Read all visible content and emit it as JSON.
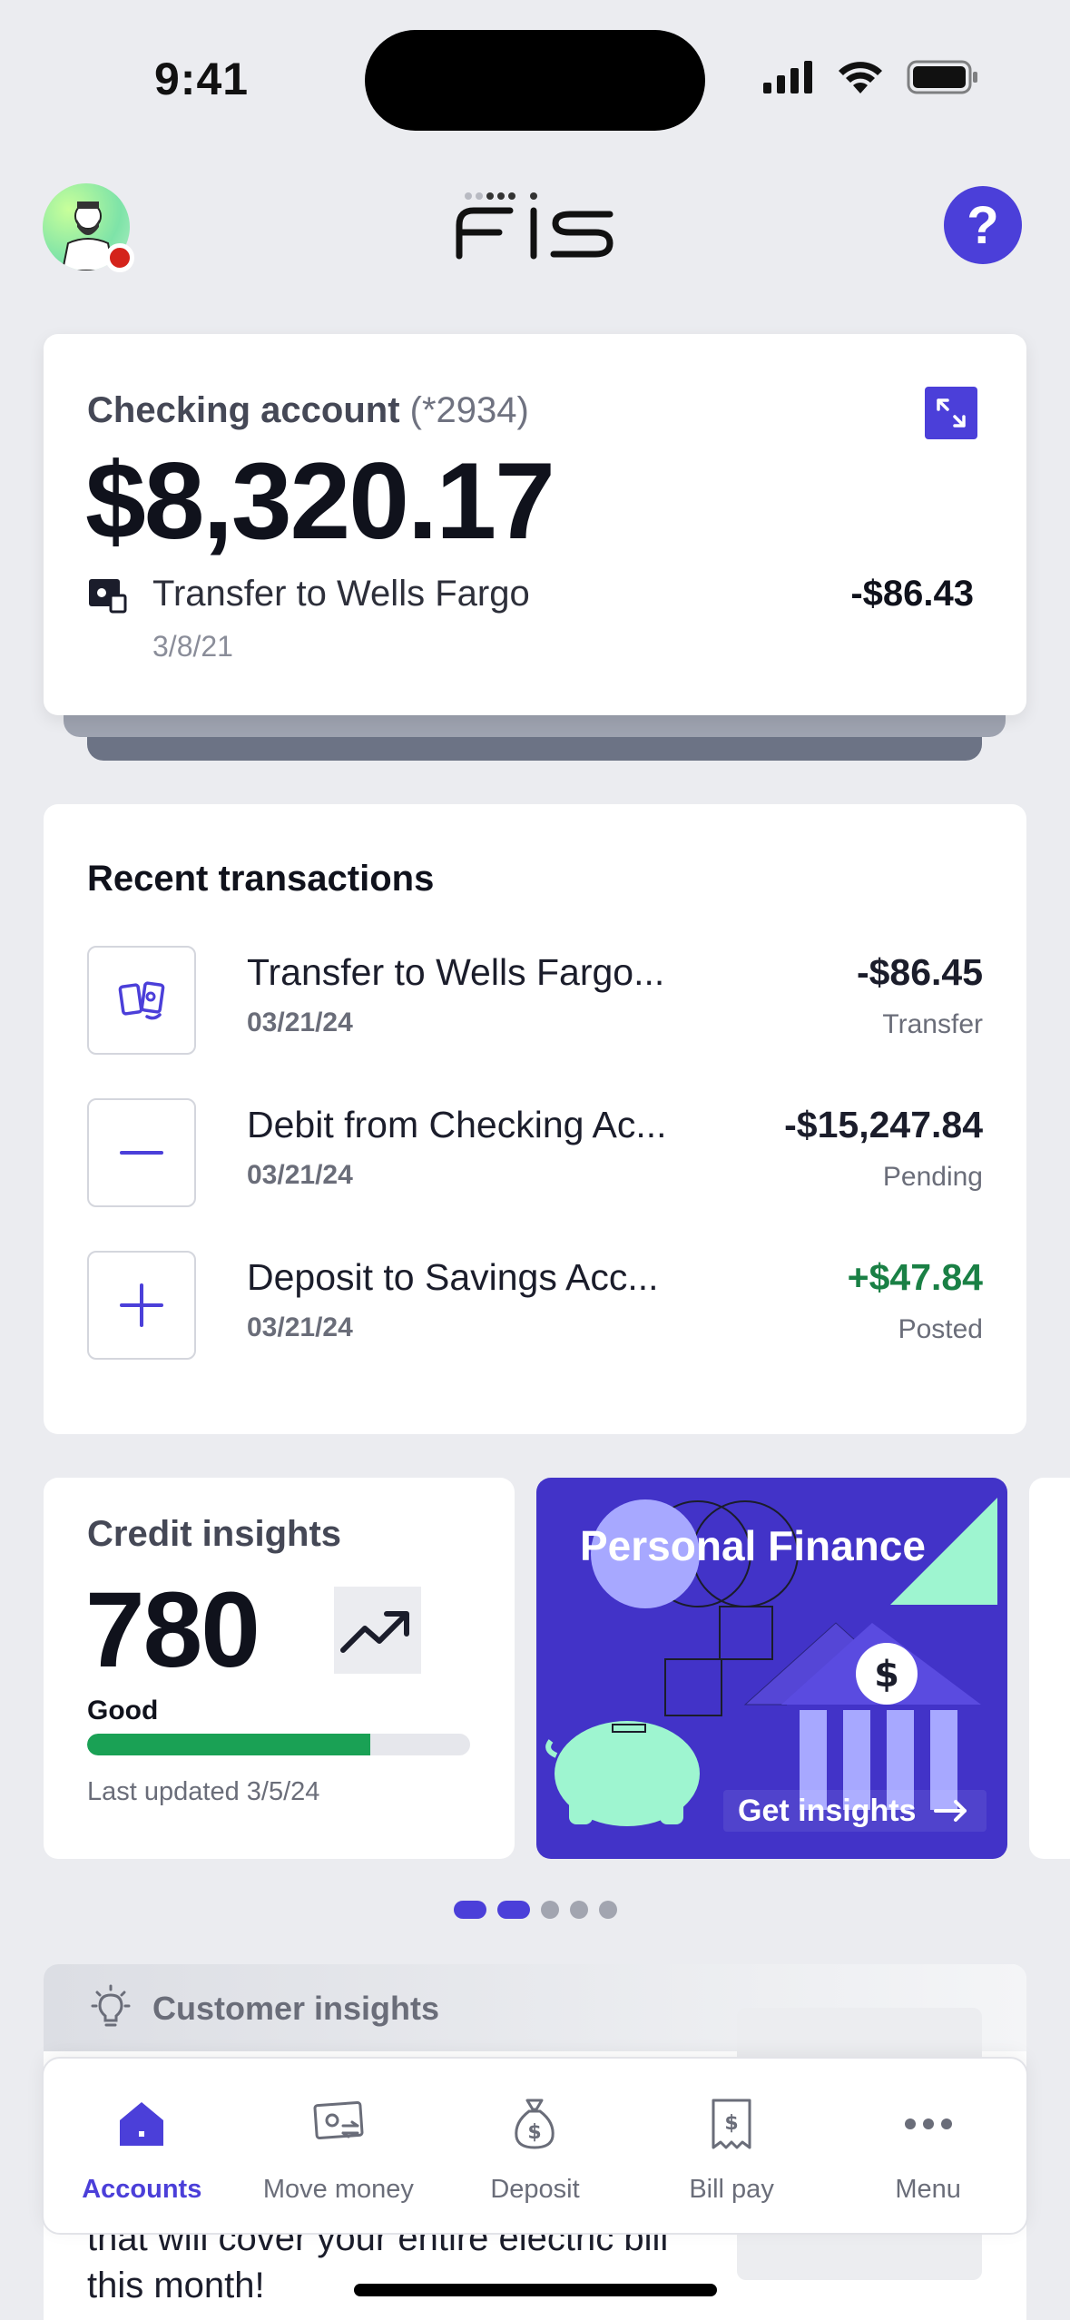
{
  "status": {
    "time": "9:41"
  },
  "header": {
    "logo_text": "FIS",
    "help_label": "?"
  },
  "account": {
    "title": "Checking account",
    "number": "(*2934)",
    "balance": "$8,320.17",
    "last_transaction": {
      "name": "Transfer to Wells Fargo",
      "amount": "-$86.43",
      "date": "3/8/21"
    }
  },
  "recent": {
    "title": "Recent transactions",
    "items": [
      {
        "icon": "transfer-icon",
        "name": "Transfer to Wells Fargo...",
        "date": "03/21/24",
        "amount": "-$86.45",
        "status": "Transfer"
      },
      {
        "icon": "minus-icon",
        "name": "Debit from Checking Ac...",
        "date": "03/21/24",
        "amount": "-$15,247.84",
        "status": "Pending"
      },
      {
        "icon": "plus-icon",
        "name": "Deposit to Savings Acc...",
        "date": "03/21/24",
        "amount": "+$47.84",
        "status": "Posted"
      }
    ]
  },
  "credit": {
    "title": "Credit insights",
    "score": "780",
    "rating": "Good",
    "progress": 0.74,
    "updated": "Last updated 3/5/24"
  },
  "personal_finance": {
    "title": "Personal Finance",
    "cta": "Get insights"
  },
  "carousel": {
    "total": 5,
    "active": 2
  },
  "insights": {
    "title": "Customer insights",
    "text": "that will cover your entire electric bill this month!"
  },
  "nav": {
    "items": [
      {
        "label": "Accounts",
        "icon": "home-icon",
        "active": true
      },
      {
        "label": "Move money",
        "icon": "move-money-icon",
        "active": false
      },
      {
        "label": "Deposit",
        "icon": "money-bag-icon",
        "active": false
      },
      {
        "label": "Bill pay",
        "icon": "bill-icon",
        "active": false
      },
      {
        "label": "Menu",
        "icon": "more-icon",
        "active": false
      }
    ]
  },
  "colors": {
    "accent": "#4b3fd9",
    "positive": "#1a8045",
    "progress": "#1aa155",
    "alert": "#d4231b"
  }
}
